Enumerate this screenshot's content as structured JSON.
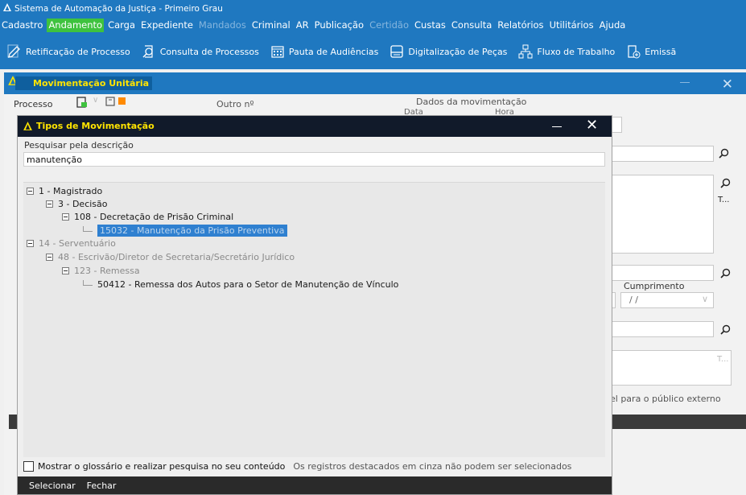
{
  "app": {
    "title": "Sistema de Automação da Justiça - Primeiro Grau",
    "accent": "#1f78c0",
    "menu_active_color": "#3ec23e",
    "highlight_text_color": "#ffe400"
  },
  "menu": [
    {
      "label": "Cadastro",
      "state": "normal"
    },
    {
      "label": "Andamento",
      "state": "active"
    },
    {
      "label": "Carga",
      "state": "normal"
    },
    {
      "label": "Expediente",
      "state": "normal"
    },
    {
      "label": "Mandados",
      "state": "disabled"
    },
    {
      "label": "Criminal",
      "state": "normal"
    },
    {
      "label": "AR",
      "state": "normal"
    },
    {
      "label": "Publicação",
      "state": "normal"
    },
    {
      "label": "Certidão",
      "state": "disabled"
    },
    {
      "label": "Custas",
      "state": "normal"
    },
    {
      "label": "Consulta",
      "state": "normal"
    },
    {
      "label": "Relatórios",
      "state": "normal"
    },
    {
      "label": "Utilitários",
      "state": "normal"
    },
    {
      "label": "Ajuda",
      "state": "normal"
    }
  ],
  "toolbar": [
    {
      "label": "Retificação de Processo",
      "icon": "pencil-icon"
    },
    {
      "label": "Consulta de Processos",
      "icon": "search-doc-icon"
    },
    {
      "label": "Pauta de Audiências",
      "icon": "calendar-icon"
    },
    {
      "label": "Digitalização de Peças",
      "icon": "scanner-icon"
    },
    {
      "label": "Fluxo de Trabalho",
      "icon": "workflow-icon"
    },
    {
      "label": "Emissã",
      "icon": "emission-icon"
    }
  ],
  "back_window": {
    "title": "Movimentação Unitária",
    "processo_label": "Processo",
    "outro_label": "Outro nº",
    "dados_label": "Dados da movimentação",
    "data_label": "Data",
    "hora_label": "Hora",
    "truncated_t1": "T...",
    "cumprimento_label": "Cumprimento",
    "cumprimento_value": "/ /",
    "truncated_t2": "T...",
    "publico_label": "el para o público externo"
  },
  "dialog": {
    "title": "Tipos de Movimentação",
    "search_label": "Pesquisar pela descrição",
    "search_value": "manutenção",
    "tree": {
      "n1": "1 - Magistrado",
      "n2": "3 - Decisão",
      "n3": "108 - Decretação de Prisão Criminal",
      "n4": "15032 - Manutenção da Prisão Preventiva",
      "n5": "14 - Serventuário",
      "n6": "48 - Escrivão/Diretor de Secretaria/Secretário Jurídico",
      "n7": "123 - Remessa",
      "n8": "50412 - Remessa dos Autos para o Setor de Manutenção de Vínculo"
    },
    "glossary_checkbox_label": "Mostrar o glossário e realizar pesquisa no seu conteúdo",
    "grey_note": "Os registros destacados em cinza não podem ser selecionados",
    "select_button": "Selecionar",
    "close_button": "Fechar"
  }
}
